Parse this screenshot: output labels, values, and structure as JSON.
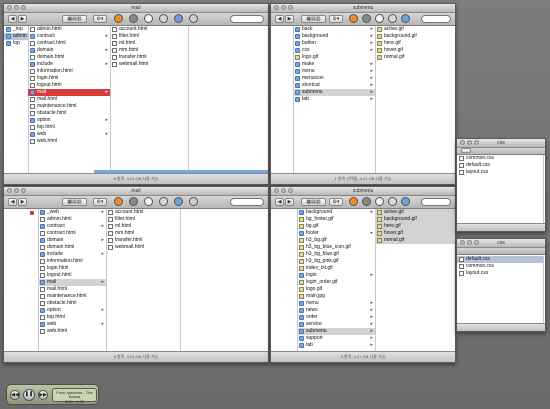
{
  "windows": {
    "mail_top": {
      "title": "mail",
      "status": "6 항목, 4.21 GB 사용 가능",
      "cols": [
        [
          {
            "t": "_top",
            "k": "folder"
          },
          {
            "t": "admin",
            "k": "folder",
            "sel": "sel"
          },
          {
            "t": "top",
            "k": "folder"
          }
        ],
        [
          {
            "t": "admin.html",
            "k": "file"
          },
          {
            "t": "contract",
            "k": "folder",
            "arr": true
          },
          {
            "t": "contract.html",
            "k": "file"
          },
          {
            "t": "domain",
            "k": "folder",
            "arr": true
          },
          {
            "t": "domain.html",
            "k": "file"
          },
          {
            "t": "include",
            "k": "folder",
            "arr": true
          },
          {
            "t": "information.html",
            "k": "file"
          },
          {
            "t": "login.html",
            "k": "file"
          },
          {
            "t": "logout.html",
            "k": "file"
          },
          {
            "t": "mail",
            "k": "folder",
            "arr": true,
            "sel": "selred"
          },
          {
            "t": "mail.html",
            "k": "file"
          },
          {
            "t": "maintenance.html",
            "k": "file"
          },
          {
            "t": "obstacle.html",
            "k": "file"
          },
          {
            "t": "option",
            "k": "folder",
            "arr": true
          },
          {
            "t": "top.html",
            "k": "file"
          },
          {
            "t": "web",
            "k": "folder",
            "arr": true
          },
          {
            "t": "web.html",
            "k": "file"
          }
        ],
        [
          {
            "t": "account.html",
            "k": "file"
          },
          {
            "t": "filter.html",
            "k": "file"
          },
          {
            "t": "ml.html",
            "k": "file"
          },
          {
            "t": "mm.html",
            "k": "file"
          },
          {
            "t": "transfer.html",
            "k": "file"
          },
          {
            "t": "webmail.html",
            "k": "file"
          }
        ],
        []
      ]
    },
    "submenu_top": {
      "title": "submenu",
      "status": "1 항목 선택됨, 4.21 GB 사용 가능",
      "cols": [
        [],
        [
          {
            "t": "back",
            "k": "folder",
            "arr": true
          },
          {
            "t": "background",
            "k": "folder",
            "arr": true
          },
          {
            "t": "button",
            "k": "folder",
            "arr": true
          },
          {
            "t": "css",
            "k": "folder",
            "arr": true
          },
          {
            "t": "logo.gif",
            "k": "gif"
          },
          {
            "t": "make",
            "k": "folder",
            "arr": true
          },
          {
            "t": "menu",
            "k": "folder",
            "arr": true
          },
          {
            "t": "menuicon",
            "k": "folder",
            "arr": true
          },
          {
            "t": "shortcut",
            "k": "folder",
            "arr": true
          },
          {
            "t": "submenu",
            "k": "folder",
            "arr": true,
            "sel": "selgray"
          },
          {
            "t": "tab",
            "k": "folder",
            "arr": true
          }
        ],
        [
          {
            "t": "active.gif",
            "k": "gif"
          },
          {
            "t": "background.gif",
            "k": "gif"
          },
          {
            "t": "here.gif",
            "k": "gif"
          },
          {
            "t": "hover.gif",
            "k": "gif"
          },
          {
            "t": "nomal.gif",
            "k": "gif"
          }
        ]
      ]
    },
    "mail_bottom": {
      "title": "mail",
      "status": "6 항목, 4.21 GB 사용 가능",
      "cols": [
        [
          {
            "t": "",
            "k": "none",
            "dot": true
          }
        ],
        [
          {
            "t": "_web",
            "k": "folder",
            "arr": true
          },
          {
            "t": "admin.html",
            "k": "file"
          },
          {
            "t": "contract",
            "k": "folder",
            "arr": true
          },
          {
            "t": "contract.html",
            "k": "file"
          },
          {
            "t": "domain",
            "k": "folder",
            "arr": true
          },
          {
            "t": "domain.html",
            "k": "file"
          },
          {
            "t": "include",
            "k": "folder",
            "arr": true
          },
          {
            "t": "information.html",
            "k": "file"
          },
          {
            "t": "login.html",
            "k": "file"
          },
          {
            "t": "logout.html",
            "k": "file"
          },
          {
            "t": "mail",
            "k": "folder",
            "arr": true,
            "sel": "selgray"
          },
          {
            "t": "mail.html",
            "k": "file"
          },
          {
            "t": "maintenance.html",
            "k": "file"
          },
          {
            "t": "obstacle.html",
            "k": "file"
          },
          {
            "t": "option",
            "k": "folder",
            "arr": true
          },
          {
            "t": "top.html",
            "k": "file"
          },
          {
            "t": "web",
            "k": "folder",
            "arr": true
          },
          {
            "t": "web.html",
            "k": "file"
          }
        ],
        [
          {
            "t": "account.html",
            "k": "file"
          },
          {
            "t": "filter.html",
            "k": "file"
          },
          {
            "t": "ml.html",
            "k": "file"
          },
          {
            "t": "mm.html",
            "k": "file"
          },
          {
            "t": "transfer.html",
            "k": "file"
          },
          {
            "t": "webmail.html",
            "k": "file"
          }
        ],
        []
      ]
    },
    "submenu_bottom": {
      "title": "submenu",
      "status": "5 항목, 4.21 GB 사용 가능",
      "cols": [
        [],
        [
          {
            "t": "background",
            "k": "folder",
            "arr": true
          },
          {
            "t": "bg_footer.gif",
            "k": "gif"
          },
          {
            "t": "bg.gif",
            "k": "gif"
          },
          {
            "t": "footer",
            "k": "folder",
            "arr": true
          },
          {
            "t": "h3_bg.gif",
            "k": "gif"
          },
          {
            "t": "h3_bg_blue_icon.gif",
            "k": "gif"
          },
          {
            "t": "h3_bg_blue.gif",
            "k": "gif"
          },
          {
            "t": "h3_bg_pink.gif",
            "k": "gif"
          },
          {
            "t": "index_txt.gif",
            "k": "gif"
          },
          {
            "t": "login",
            "k": "folder",
            "arr": true
          },
          {
            "t": "login_order.gif",
            "k": "gif"
          },
          {
            "t": "logo.gif",
            "k": "gif"
          },
          {
            "t": "main.jpg",
            "k": "gif"
          },
          {
            "t": "menu",
            "k": "folder",
            "arr": true
          },
          {
            "t": "news",
            "k": "folder",
            "arr": true
          },
          {
            "t": "order",
            "k": "folder",
            "arr": true
          },
          {
            "t": "service",
            "k": "folder",
            "arr": true
          },
          {
            "t": "submenu",
            "k": "folder",
            "arr": true,
            "sel": "selgray"
          },
          {
            "t": "support",
            "k": "folder",
            "arr": true
          },
          {
            "t": "tab",
            "k": "folder",
            "arr": true
          }
        ],
        [
          {
            "t": "active.gif",
            "k": "gif",
            "sel": "selgray"
          },
          {
            "t": "background.gif",
            "k": "gif",
            "sel": "selgray"
          },
          {
            "t": "here.gif",
            "k": "gif",
            "sel": "selgray"
          },
          {
            "t": "hover.gif",
            "k": "gif",
            "sel": "selgray"
          },
          {
            "t": "nomal.gif",
            "k": "gif",
            "sel": "selgray"
          }
        ]
      ]
    },
    "css_top": {
      "title": "css",
      "status": "",
      "cols": [
        [
          {
            "t": "common.css",
            "k": "file"
          },
          {
            "t": "default.css",
            "k": "file"
          },
          {
            "t": "layout.css",
            "k": "file"
          }
        ]
      ]
    },
    "css_bottom": {
      "title": "css",
      "status": "",
      "cols": [
        [
          {
            "t": "default.css",
            "k": "file",
            "sel": "sel"
          },
          {
            "t": "common.css",
            "k": "file"
          },
          {
            "t": "layout.css",
            "k": "file"
          }
        ]
      ]
    }
  },
  "player": {
    "line1": "From Ipanema - The Bossa",
    "line2": "3/10 - 4:22",
    "prev": "◀◀",
    "play": "❚❚",
    "next": "▶▶"
  }
}
